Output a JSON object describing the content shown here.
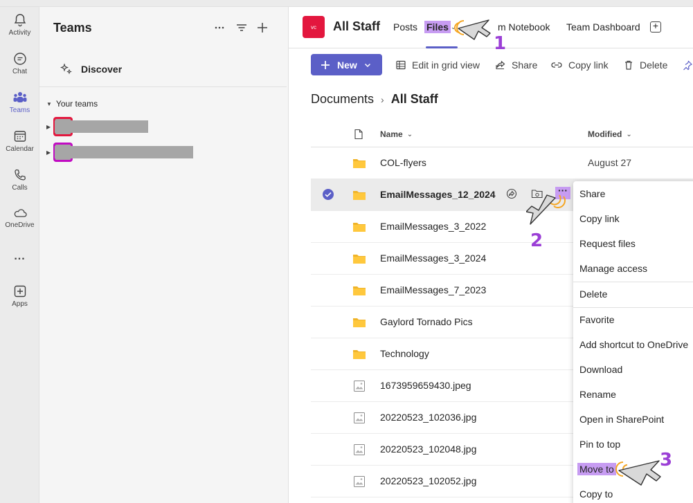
{
  "rail": {
    "items": [
      {
        "label": "Activity",
        "icon": "bell-icon"
      },
      {
        "label": "Chat",
        "icon": "chat-icon"
      },
      {
        "label": "Teams",
        "icon": "teams-icon"
      },
      {
        "label": "Calendar",
        "icon": "calendar-icon"
      },
      {
        "label": "Calls",
        "icon": "phone-icon"
      },
      {
        "label": "OneDrive",
        "icon": "cloud-icon"
      },
      {
        "label": "...",
        "icon": "more-icon"
      },
      {
        "label": "Apps",
        "icon": "add-apps-icon"
      }
    ],
    "active": "Teams",
    "accent": "#5b5fc7"
  },
  "teams_panel": {
    "title": "Teams",
    "discover_label": "Discover",
    "section_label": "Your teams",
    "teams": [
      {
        "color": "#e3173e"
      },
      {
        "color": "#c10cc2"
      }
    ]
  },
  "header": {
    "logo_text": "vc",
    "team_name": "All Staff",
    "tabs": [
      {
        "label": "Posts"
      },
      {
        "label": "Files"
      },
      {
        "label": "m Notebook"
      },
      {
        "label": "Team Dashboard"
      }
    ],
    "active_tab": "Files"
  },
  "toolbar": {
    "new_label": "New",
    "edit_grid_label": "Edit in grid view",
    "share_label": "Share",
    "copy_link_label": "Copy link",
    "delete_label": "Delete"
  },
  "breadcrumb": {
    "root": "Documents",
    "current": "All Staff"
  },
  "file_list": {
    "columns": {
      "name": "Name",
      "modified": "Modified"
    },
    "rows": [
      {
        "name": "COL-flyers",
        "type": "folder",
        "modified": "August 27"
      },
      {
        "name": "EmailMessages_12_2024",
        "type": "folder",
        "modified": "",
        "selected": true
      },
      {
        "name": "EmailMessages_3_2022",
        "type": "folder",
        "modified": ""
      },
      {
        "name": "EmailMessages_3_2024",
        "type": "folder",
        "modified": ""
      },
      {
        "name": "EmailMessages_7_2023",
        "type": "folder",
        "modified": ""
      },
      {
        "name": "Gaylord Tornado Pics",
        "type": "folder",
        "modified": ""
      },
      {
        "name": "Technology",
        "type": "folder",
        "modified": ""
      },
      {
        "name": "1673959659430.jpeg",
        "type": "image",
        "modified": ""
      },
      {
        "name": "20220523_102036.jpg",
        "type": "image",
        "modified": ""
      },
      {
        "name": "20220523_102048.jpg",
        "type": "image",
        "modified": ""
      },
      {
        "name": "20220523_102052.jpg",
        "type": "image",
        "modified": ""
      }
    ],
    "more_label": "···"
  },
  "context_menu": {
    "items": [
      "Share",
      "Copy link",
      "Request files",
      "Manage access",
      "Delete",
      "Favorite",
      "Add shortcut to OneDrive",
      "Download",
      "Rename",
      "Open in SharePoint",
      "Pin to top",
      "Move to",
      "Copy to"
    ],
    "highlighted": "Move to"
  },
  "annotations": {
    "steps": [
      "1",
      "2",
      "3"
    ],
    "highlight_color": "#c79cf2",
    "number_color": "#9b3fd6"
  }
}
